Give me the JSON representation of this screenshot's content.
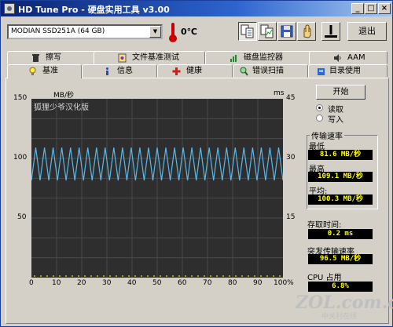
{
  "window": {
    "title": "HD Tune Pro - 硬盘实用工具 v3.00"
  },
  "toolbar": {
    "drive": "MODIAN SSD251A (64 GB)",
    "temperature": "0℃",
    "exit_label": "退出"
  },
  "tabs_top": [
    {
      "label": "擦写",
      "icon": "trash-icon"
    },
    {
      "label": "文件基准测试",
      "icon": "file-benchmark-icon"
    },
    {
      "label": "磁盘监控器",
      "icon": "disk-monitor-icon"
    },
    {
      "label": "AAM",
      "icon": "speaker-icon"
    }
  ],
  "tabs_bottom": [
    {
      "label": "基准",
      "icon": "bulb-icon",
      "selected": true
    },
    {
      "label": "信息",
      "icon": "info-icon"
    },
    {
      "label": "健康",
      "icon": "red-cross-icon"
    },
    {
      "label": "错误扫描",
      "icon": "magnifier-icon"
    },
    {
      "label": "目录使用",
      "icon": "folder-icon"
    }
  ],
  "graph": {
    "overlay_text": "狐狸少爷汉化版",
    "left_unit": "MB/秒",
    "right_unit": "ms",
    "left_ticks": [
      "150",
      "100",
      "50"
    ],
    "right_ticks": [
      "45",
      "30",
      "15"
    ],
    "x_ticks": [
      "0",
      "10",
      "20",
      "30",
      "40",
      "50",
      "60",
      "70",
      "80",
      "90",
      "100%"
    ]
  },
  "chart_data": {
    "type": "line",
    "x_unit": "%",
    "xlim": [
      0,
      100
    ],
    "ylim_left": [
      0,
      150
    ],
    "ylim_right": [
      0,
      45
    ],
    "series": [
      {
        "name": "传输速率",
        "color": "#5bb8ea",
        "min": 81.6,
        "max": 109.1,
        "avg": 100.3
      },
      {
        "name": "存取时间",
        "color": "#e8e800",
        "value_ms": 0.2
      }
    ]
  },
  "controls": {
    "start_label": "开始",
    "read_label": "读取",
    "write_label": "写入",
    "mode_selected": "read"
  },
  "stats": {
    "transfer_title": "传输速率",
    "min_label": "最低",
    "min_value": "81.6 MB/秒",
    "max_label": "最高",
    "max_value": "109.1 MB/秒",
    "avg_label": "平均:",
    "avg_value": "100.3 MB/秒",
    "access_label": "存取时间:",
    "access_value": "0.2 ms",
    "burst_label": "突发传输速率",
    "burst_value": "96.5 MB/秒",
    "cpu_label": "CPU 占用",
    "cpu_value": "6.8%"
  },
  "watermark": {
    "text": "ZOL.com.cn",
    "sub": "中关村在线"
  }
}
